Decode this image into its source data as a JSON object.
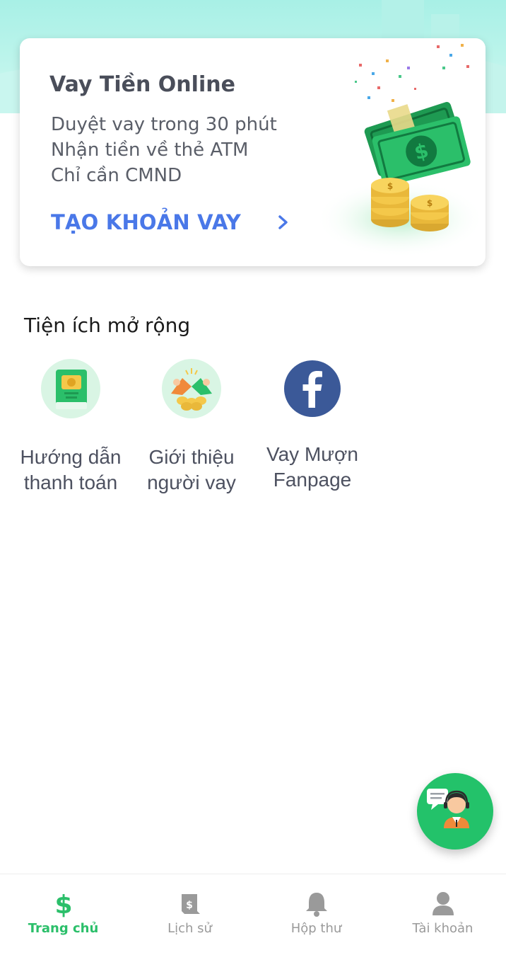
{
  "banner": {
    "title": "Vay Tiền Online",
    "lines": [
      "Duyệt vay trong 30 phút",
      "Nhận tiền về thẻ ATM",
      "Chỉ cần CMND"
    ],
    "cta_label": "TẠO KHOẢN VAY"
  },
  "section": {
    "title": "Tiện ích mở rộng",
    "tools": [
      {
        "label_line1": "Hướng dẫn",
        "label_line2": "thanh toán",
        "icon": "payment-guide-icon"
      },
      {
        "label_line1": "Giới thiệu",
        "label_line2": "người vay",
        "icon": "referral-icon"
      },
      {
        "label_line1": "Vay Mượn",
        "label_line2": "Fanpage",
        "icon": "facebook-icon"
      }
    ]
  },
  "nav": {
    "items": [
      {
        "label": "Trang chủ",
        "icon": "dollar-icon",
        "active": true
      },
      {
        "label": "Lịch sử",
        "icon": "receipt-icon",
        "active": false
      },
      {
        "label": "Hộp thư",
        "icon": "bell-icon",
        "active": false
      },
      {
        "label": "Tài khoản",
        "icon": "user-icon",
        "active": false
      }
    ]
  },
  "colors": {
    "accent_green": "#2bbf6a",
    "cta_blue": "#4a78e8",
    "facebook_blue": "#3b5998"
  }
}
